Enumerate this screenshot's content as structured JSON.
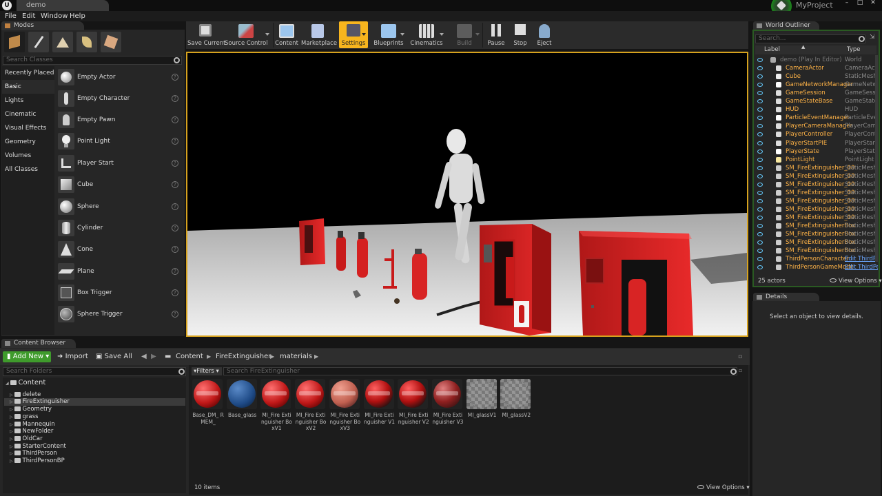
{
  "titlebar": {
    "logo": "U",
    "doc_tab": "demo",
    "project": "MyProject",
    "win_min": "–",
    "win_max": "□",
    "win_close": "✕"
  },
  "menu": [
    "File",
    "Edit",
    "Window",
    "Help"
  ],
  "modes": {
    "tab": "Modes",
    "search_placeholder": "Search Classes",
    "categories": [
      "Recently Placed",
      "Basic",
      "Lights",
      "Cinematic",
      "Visual Effects",
      "Geometry",
      "Volumes",
      "All Classes"
    ],
    "items": [
      "Empty Actor",
      "Empty Character",
      "Empty Pawn",
      "Point Light",
      "Player Start",
      "Cube",
      "Sphere",
      "Cylinder",
      "Cone",
      "Plane",
      "Box Trigger",
      "Sphere Trigger"
    ],
    "help": "?"
  },
  "toolbar": [
    "Save Current",
    "Source Control",
    "Content",
    "Marketplace",
    "Settings",
    "Blueprints",
    "Cinematics",
    "Build",
    "Pause",
    "Stop",
    "Eject"
  ],
  "outliner": {
    "tab": "World Outliner",
    "search_placeholder": "Search...",
    "col_label": "Label",
    "col_type": "Type",
    "rows": [
      {
        "label": "demo (Play In Editor)",
        "type": "World"
      },
      {
        "label": "CameraActor",
        "type": "CameraActor"
      },
      {
        "label": "Cube",
        "type": "StaticMeshAc"
      },
      {
        "label": "GameNetworkManager",
        "type": "GameNetwork"
      },
      {
        "label": "GameSession",
        "type": "GameSession"
      },
      {
        "label": "GameStateBase",
        "type": "GameStateBa"
      },
      {
        "label": "HUD",
        "type": "HUD"
      },
      {
        "label": "ParticleEventManager",
        "type": "ParticleEvent"
      },
      {
        "label": "PlayerCameraManager",
        "type": "PlayerCamer"
      },
      {
        "label": "PlayerController",
        "type": "PlayerContro"
      },
      {
        "label": "PlayerStartPIE",
        "type": "PlayerStartPI"
      },
      {
        "label": "PlayerState",
        "type": "PlayerState"
      },
      {
        "label": "PointLight",
        "type": "PointLight"
      },
      {
        "label": "SM_FireExtinguisher_00",
        "type": "StaticMeshAc"
      },
      {
        "label": "SM_FireExtinguisher_00",
        "type": "StaticMeshAc"
      },
      {
        "label": "SM_FireExtinguisher_00",
        "type": "StaticMeshAc"
      },
      {
        "label": "SM_FireExtinguisher_00",
        "type": "StaticMeshAc"
      },
      {
        "label": "SM_FireExtinguisher_00",
        "type": "StaticMeshAc"
      },
      {
        "label": "SM_FireExtinguisher_00",
        "type": "StaticMeshAc"
      },
      {
        "label": "SM_FireExtinguisher_00",
        "type": "StaticMeshAc"
      },
      {
        "label": "SM_FireExtinguisherBox",
        "type": "StaticMeshAc"
      },
      {
        "label": "SM_FireExtinguisherBox",
        "type": "StaticMeshAc"
      },
      {
        "label": "SM_FireExtinguisherBox",
        "type": "StaticMeshAc"
      },
      {
        "label": "SM_FireExtinguisherBox",
        "type": "StaticMeshAc"
      },
      {
        "label": "ThirdPersonCharacter",
        "type": "Edit ThirdPe"
      },
      {
        "label": "ThirdPersonGameMode",
        "type": "Edit ThirdPe"
      }
    ],
    "actor_count": "25 actors",
    "view_options": "View Options"
  },
  "details": {
    "tab": "Details",
    "empty_message": "Select an object to view details."
  },
  "content_browser": {
    "tab": "Content Browser",
    "add_new": "Add New",
    "import": "Import",
    "save_all": "Save All",
    "path": [
      "Content",
      "FireExtinguisher",
      "materials"
    ],
    "search_folders_placeholder": "Search Folders",
    "filters": "Filters",
    "search_placeholder": "Search FireExtinguisher",
    "folders": [
      {
        "name": "Content",
        "root": true
      },
      {
        "name": "delete"
      },
      {
        "name": "FireExtinguisher",
        "selected": true
      },
      {
        "name": "Geometry"
      },
      {
        "name": "grass"
      },
      {
        "name": "Mannequin"
      },
      {
        "name": "NewFolder"
      },
      {
        "name": "OldCar"
      },
      {
        "name": "StarterContent"
      },
      {
        "name": "ThirdPerson"
      },
      {
        "name": "ThirdPersonBP"
      }
    ],
    "assets": [
      {
        "name": "Base_DM_ RMEM_",
        "kind": "red"
      },
      {
        "name": "Base_glass",
        "kind": "blue"
      },
      {
        "name": "MI_Fire Extinguisher BoxV1",
        "kind": "red"
      },
      {
        "name": "MI_Fire Extinguisher BoxV2",
        "kind": "red"
      },
      {
        "name": "MI_Fire Extinguisher BoxV3",
        "kind": "salmon"
      },
      {
        "name": "MI_Fire Extinguisher V1",
        "kind": "redblack"
      },
      {
        "name": "MI_Fire Extinguisher V2",
        "kind": "redblack"
      },
      {
        "name": "MI_Fire Extinguisher V3",
        "kind": "darkred"
      },
      {
        "name": "MI_glassV1",
        "kind": "checker"
      },
      {
        "name": "MI_glassV2",
        "kind": "checker"
      }
    ],
    "item_count": "10 items",
    "view_options": "View Options"
  },
  "colors": {
    "accent": "#f7b51e",
    "add_new": "#3f9b2c",
    "selected_folder": "#3b3b3b",
    "outliner_label": "#ffb347"
  }
}
